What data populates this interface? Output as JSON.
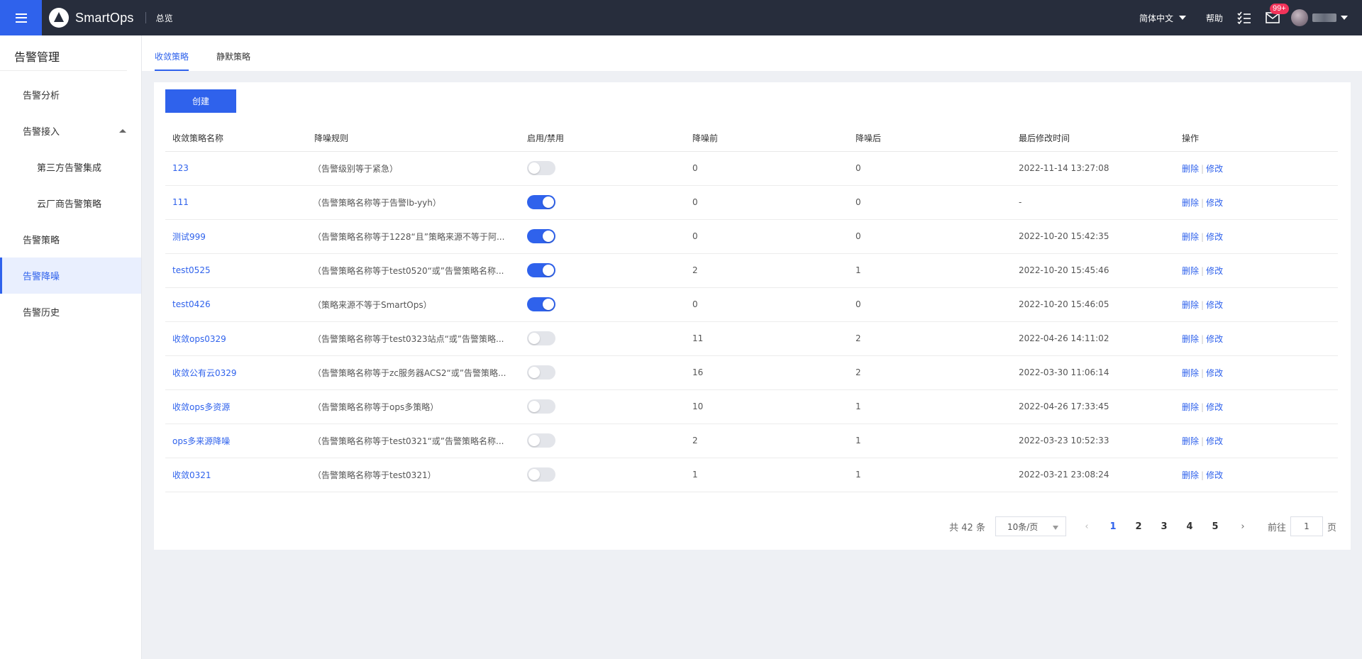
{
  "app": {
    "name": "SmartOps",
    "nav_overview": "总览",
    "language": "简体中文",
    "help": "帮助",
    "notification_badge": "99+"
  },
  "sidebar": {
    "title": "告警管理",
    "items": [
      {
        "label": "告警分析"
      },
      {
        "label": "告警接入"
      },
      {
        "label": "第三方告警集成"
      },
      {
        "label": "云厂商告警策略"
      },
      {
        "label": "告警策略"
      },
      {
        "label": "告警降噪"
      },
      {
        "label": "告警历史"
      }
    ]
  },
  "tabs": [
    {
      "label": "收敛策略"
    },
    {
      "label": "静默策略"
    }
  ],
  "toolbar": {
    "create_label": "创建"
  },
  "table": {
    "columns": [
      "收敛策略名称",
      "降噪规则",
      "启用/禁用",
      "降噪前",
      "降噪后",
      "最后修改时间",
      "操作"
    ],
    "delete_label": "删除",
    "edit_label": "修改",
    "rows": [
      {
        "name": "123",
        "rule": "（告警级别等于紧急）",
        "enabled": false,
        "before": "0",
        "after": "0",
        "modified": "2022-11-14 13:27:08"
      },
      {
        "name": "111",
        "rule": "（告警策略名称等于告警lb-yyh）",
        "enabled": true,
        "before": "0",
        "after": "0",
        "modified": "-"
      },
      {
        "name": "测试999",
        "rule": "（告警策略名称等于1228“且”策略来源不等于阿...",
        "enabled": true,
        "before": "0",
        "after": "0",
        "modified": "2022-10-20 15:42:35"
      },
      {
        "name": "test0525",
        "rule": "（告警策略名称等于test0520“或”告警策略名称...",
        "enabled": true,
        "before": "2",
        "after": "1",
        "modified": "2022-10-20 15:45:46"
      },
      {
        "name": "test0426",
        "rule": "（策略来源不等于SmartOps）",
        "enabled": true,
        "before": "0",
        "after": "0",
        "modified": "2022-10-20 15:46:05"
      },
      {
        "name": "收敛ops0329",
        "rule": "（告警策略名称等于test0323站点“或”告警策略...",
        "enabled": false,
        "before": "11",
        "after": "2",
        "modified": "2022-04-26 14:11:02"
      },
      {
        "name": "收敛公有云0329",
        "rule": "（告警策略名称等于zc服务器ACS2“或”告警策略...",
        "enabled": false,
        "before": "16",
        "after": "2",
        "modified": "2022-03-30 11:06:14"
      },
      {
        "name": "收敛ops多资源",
        "rule": "（告警策略名称等于ops多策略）",
        "enabled": false,
        "before": "10",
        "after": "1",
        "modified": "2022-04-26 17:33:45"
      },
      {
        "name": "ops多来源降噪",
        "rule": "（告警策略名称等于test0321“或”告警策略名称...",
        "enabled": false,
        "before": "2",
        "after": "1",
        "modified": "2022-03-23 10:52:33"
      },
      {
        "name": "收敛0321",
        "rule": "（告警策略名称等于test0321）",
        "enabled": false,
        "before": "1",
        "after": "1",
        "modified": "2022-03-21 23:08:24"
      }
    ]
  },
  "pagination": {
    "total_label": "共 42 条",
    "page_size": "10条/页",
    "pages": [
      "1",
      "2",
      "3",
      "4",
      "5"
    ],
    "current_page": "1",
    "goto_label": "前往",
    "goto_value": "1",
    "page_suffix": "页"
  },
  "colors": {
    "accent": "#2f62ec",
    "topbar": "#272d3c",
    "badge": "#f2335a"
  }
}
